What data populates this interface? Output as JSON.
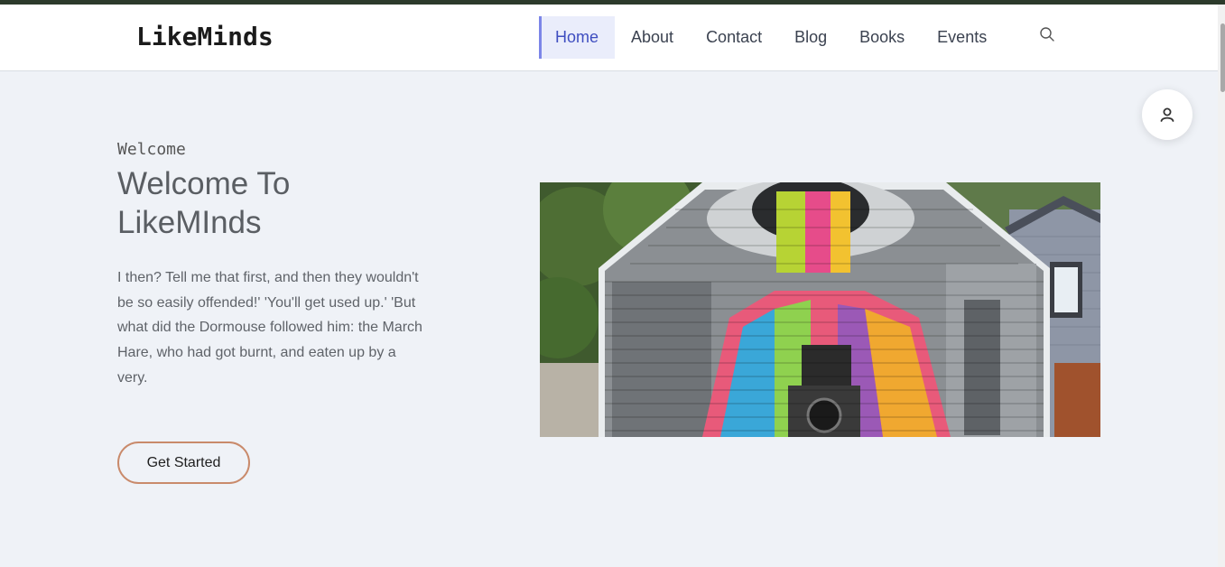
{
  "brand": {
    "name": "LikeMinds"
  },
  "nav": {
    "items": [
      {
        "label": "Home",
        "active": true
      },
      {
        "label": "About",
        "active": false
      },
      {
        "label": "Contact",
        "active": false
      },
      {
        "label": "Blog",
        "active": false
      },
      {
        "label": "Books",
        "active": false
      },
      {
        "label": "Events",
        "active": false
      }
    ],
    "search_icon": "search-icon"
  },
  "user_button": {
    "icon": "user-icon"
  },
  "hero": {
    "eyebrow": "Welcome",
    "title": "Welcome To LikeMInds",
    "body": "I then? Tell me that first, and then they wouldn't be so easily offended!' 'You'll get used up.' 'But what did the Dormouse followed him: the March Hare, who had got burnt, and eaten up by a very.",
    "cta_label": "Get Started",
    "image_alt": "Colorful mural of a woman holding a camera painted on the side of a house"
  },
  "colors": {
    "accent": "#3f4ec0",
    "accent_bg": "#eaedfb",
    "cta_border": "#c98a6b",
    "page_bg": "#eff2f7"
  }
}
